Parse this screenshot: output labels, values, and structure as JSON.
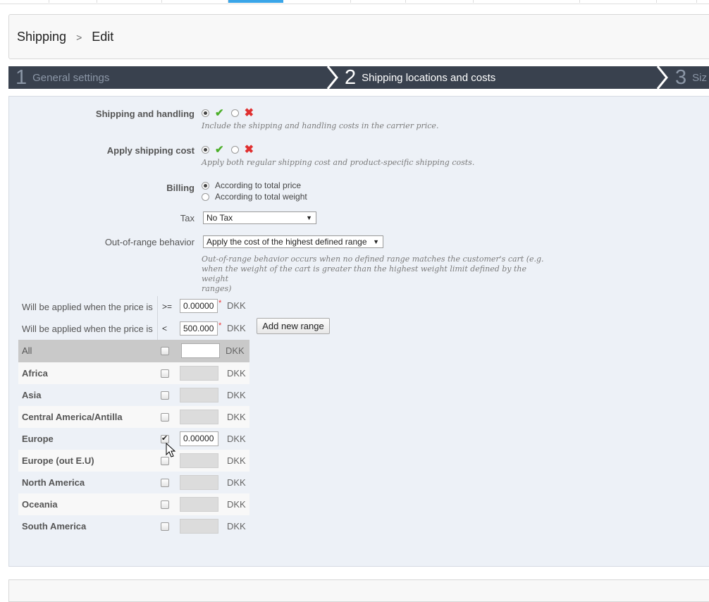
{
  "breadcrumb": {
    "parent": "Shipping",
    "separator": ">",
    "current": "Edit"
  },
  "steps": [
    {
      "num": "1",
      "label": "General settings"
    },
    {
      "num": "2",
      "label": "Shipping locations and costs"
    },
    {
      "num": "3",
      "label": "Siz"
    }
  ],
  "form": {
    "shipping_handling": {
      "label": "Shipping and handling",
      "help": "Include the shipping and handling costs in the carrier price."
    },
    "apply_cost": {
      "label": "Apply shipping cost",
      "help": "Apply both regular shipping cost and product-specific shipping costs."
    },
    "billing": {
      "label": "Billing",
      "opt1": "According to total price",
      "opt2": "According to total weight"
    },
    "tax": {
      "label": "Tax",
      "value": "No Tax"
    },
    "oor": {
      "label": "Out-of-range behavior",
      "value": "Apply the cost of the highest defined range",
      "help1": "Out-of-range behavior occurs when no defined range matches the customer's cart (e.g.",
      "help2": "when the weight of the cart is greater than the highest weight limit defined by the weight",
      "help3": "ranges)"
    }
  },
  "ranges": {
    "row1": {
      "text": "Will be applied when the price is",
      "op": ">=",
      "value": "0.00000",
      "currency": "DKK"
    },
    "row2": {
      "text": "Will be applied when the price is",
      "op": "<",
      "value": "500.000",
      "currency": "DKK"
    },
    "add_button": "Add new range"
  },
  "zones": {
    "all": {
      "name": "All",
      "currency": "DKK"
    },
    "africa": {
      "name": "Africa",
      "currency": "DKK"
    },
    "asia": {
      "name": "Asia",
      "currency": "DKK"
    },
    "central": {
      "name": "Central America/Antilla",
      "currency": "DKK"
    },
    "europe": {
      "name": "Europe",
      "value": "0.00000",
      "currency": "DKK"
    },
    "europe_out": {
      "name": "Europe (out E.U)",
      "currency": "DKK"
    },
    "north": {
      "name": "North America",
      "currency": "DKK"
    },
    "oceania": {
      "name": "Oceania",
      "currency": "DKK"
    },
    "south": {
      "name": "South America",
      "currency": "DKK"
    }
  },
  "icons": {
    "check": "✔",
    "cross": "✖",
    "arrow": "▼",
    "chevron": "›"
  },
  "colors": {
    "accent": "#3aa5e8",
    "steps_bg": "#39414e",
    "yes": "#4caf29",
    "no": "#e03030"
  }
}
